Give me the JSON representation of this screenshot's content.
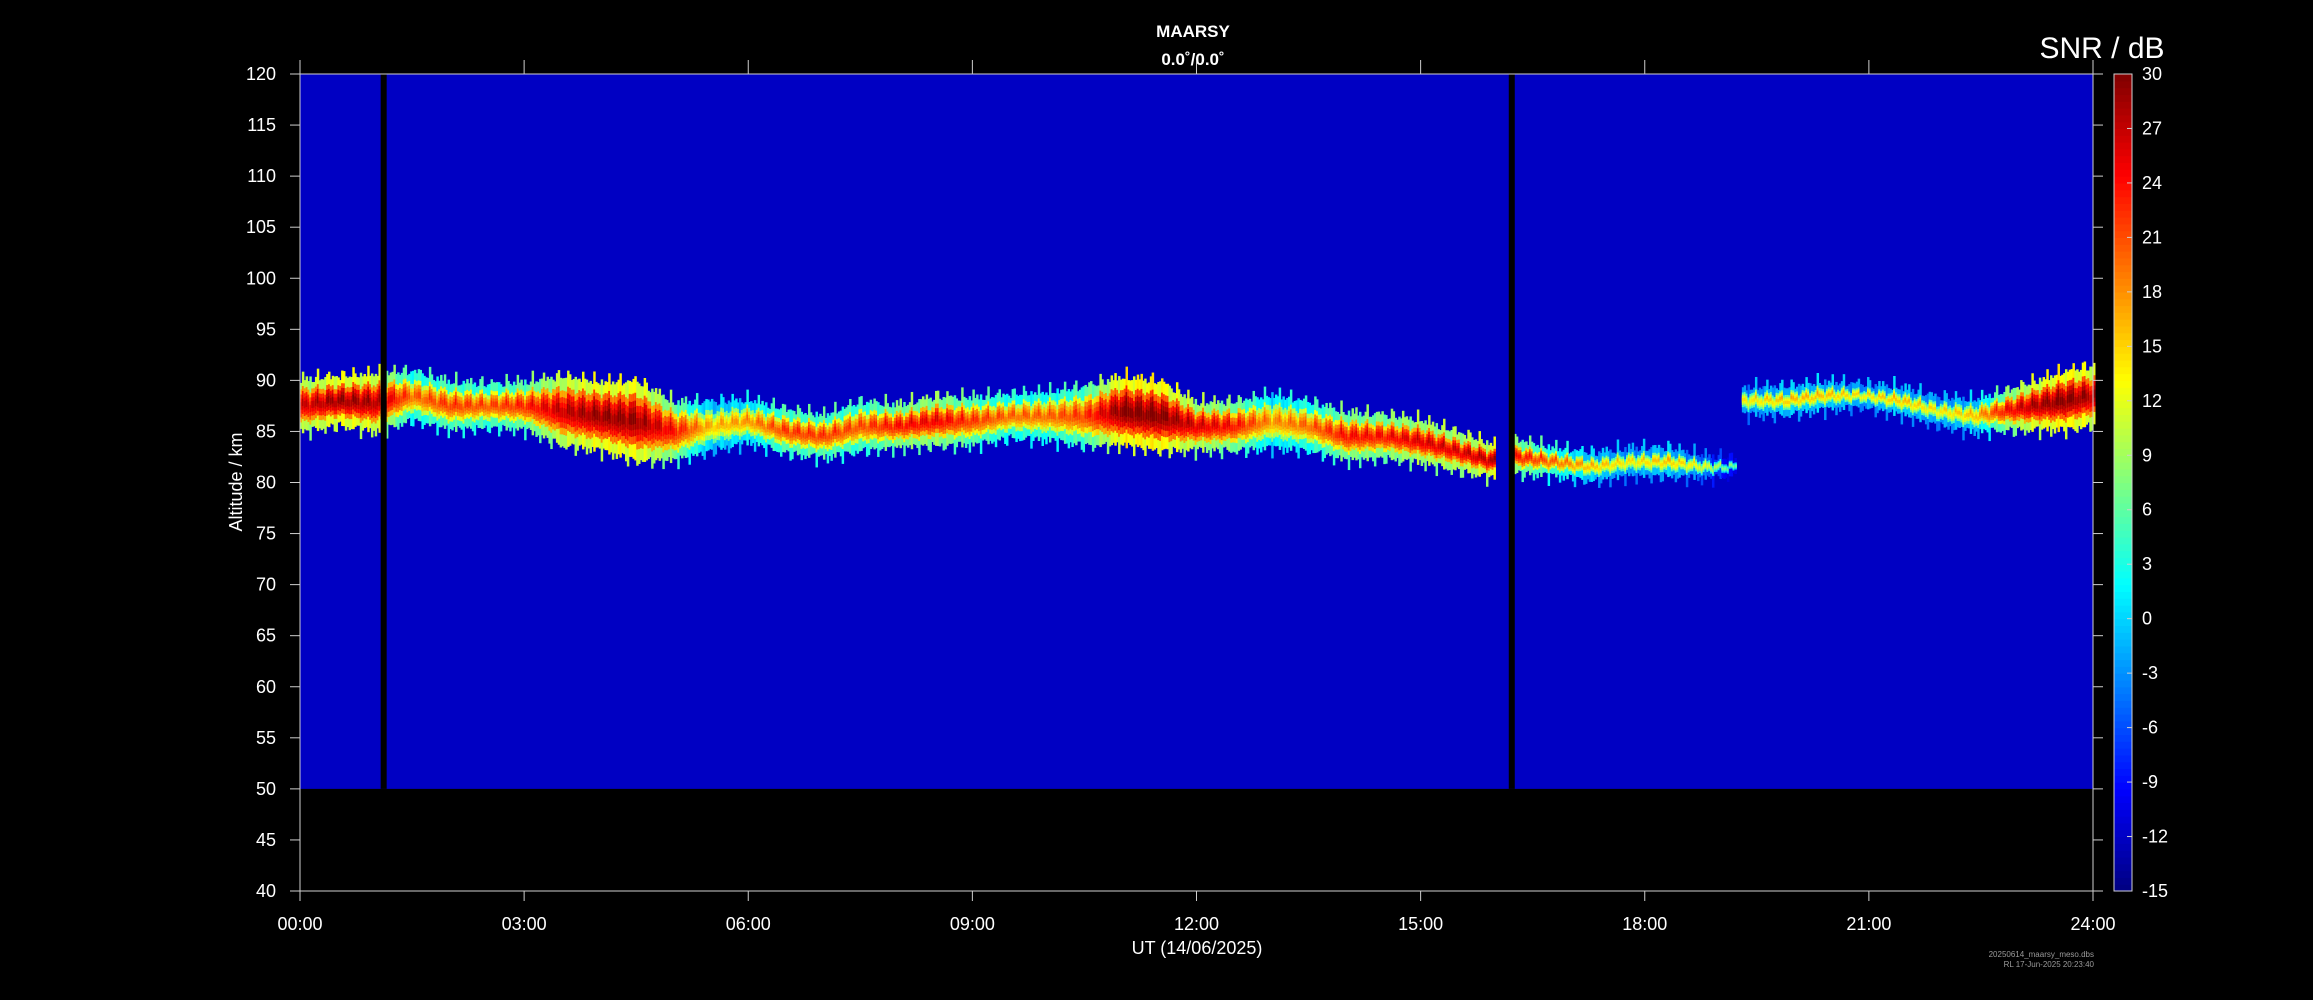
{
  "chart_data": {
    "type": "heatmap",
    "title": "MAARSY",
    "subtitle": "0.0˚/0.0˚",
    "xlabel": "UT (14/06/2025)",
    "ylabel": "Altitude / km",
    "x_range_hours": [
      0,
      24
    ],
    "ylim": [
      40,
      120
    ],
    "x_ticks": [
      "00:00",
      "03:00",
      "06:00",
      "09:00",
      "12:00",
      "15:00",
      "18:00",
      "21:00",
      "24:00"
    ],
    "y_ticks": [
      40,
      45,
      50,
      55,
      60,
      65,
      70,
      75,
      80,
      85,
      90,
      95,
      100,
      105,
      110,
      115,
      120
    ],
    "data_floor_km": 50,
    "background_snr_db": -12,
    "colorbar": {
      "label": "SNR / dB",
      "range": [
        -15,
        30
      ],
      "ticks": [
        -15,
        -12,
        -9,
        -6,
        -3,
        0,
        3,
        6,
        9,
        12,
        15,
        18,
        21,
        24,
        27,
        30
      ],
      "colormap": "jet"
    },
    "data_gaps_ut_hours": [
      1.12,
      16.22
    ],
    "echo_layer": {
      "description_unit": "km",
      "segments": [
        {
          "start_h": 0.0,
          "end_h": 16.0,
          "points": [
            [
              0.0,
              87.5,
              4.5,
              24
            ],
            [
              0.5,
              88,
              4,
              27
            ],
            [
              1.0,
              87.8,
              5,
              26
            ],
            [
              1.5,
              88.5,
              4,
              18
            ],
            [
              2.0,
              87.5,
              4,
              20
            ],
            [
              2.5,
              87.5,
              3.5,
              19
            ],
            [
              3.0,
              87.5,
              4,
              21
            ],
            [
              3.5,
              87,
              6,
              25
            ],
            [
              4.0,
              86.5,
              6,
              27
            ],
            [
              4.5,
              86,
              7,
              27
            ],
            [
              5.0,
              85,
              5,
              22
            ],
            [
              5.5,
              85.5,
              4,
              14
            ],
            [
              6.0,
              86,
              3.5,
              16
            ],
            [
              6.5,
              85,
              3.5,
              20
            ],
            [
              7.0,
              84.5,
              3.5,
              20
            ],
            [
              7.5,
              85.5,
              4,
              19
            ],
            [
              8.0,
              85.5,
              3.5,
              22
            ],
            [
              8.5,
              86,
              4,
              23
            ],
            [
              9.0,
              86,
              4,
              20
            ],
            [
              9.5,
              86.5,
              3.5,
              18
            ],
            [
              10.0,
              86.5,
              4,
              18
            ],
            [
              10.5,
              86.5,
              5,
              20
            ],
            [
              11.0,
              87,
              6,
              28
            ],
            [
              11.5,
              86.5,
              6,
              28
            ],
            [
              12.0,
              85.5,
              4,
              24
            ],
            [
              12.5,
              85.5,
              4,
              22
            ],
            [
              13.0,
              86,
              4.5,
              16
            ],
            [
              13.5,
              85.5,
              4,
              18
            ],
            [
              14.0,
              84.5,
              4,
              22
            ],
            [
              14.5,
              84.5,
              3.5,
              22
            ],
            [
              15.0,
              84,
              3.5,
              24
            ],
            [
              15.5,
              83,
              3,
              24
            ],
            [
              16.0,
              82,
              2.5,
              26
            ]
          ]
        },
        {
          "start_h": 16.25,
          "end_h": 19.2,
          "points": [
            [
              16.3,
              82.5,
              2.5,
              22
            ],
            [
              16.8,
              82,
              2,
              18
            ],
            [
              17.3,
              81.5,
              2,
              14
            ],
            [
              17.8,
              82,
              2,
              12
            ],
            [
              18.3,
              82,
              2,
              14
            ],
            [
              18.8,
              81.5,
              1.5,
              10
            ],
            [
              19.2,
              81.5,
              1,
              4
            ]
          ]
        },
        {
          "start_h": 19.3,
          "end_h": 24.0,
          "points": [
            [
              19.4,
              88,
              2,
              12
            ],
            [
              19.9,
              88,
              2,
              14
            ],
            [
              20.4,
              88.5,
              2,
              14
            ],
            [
              20.9,
              88.5,
              1.5,
              12
            ],
            [
              21.4,
              88,
              2,
              14
            ],
            [
              21.9,
              87,
              2,
              12
            ],
            [
              22.4,
              86.5,
              2.5,
              14
            ],
            [
              22.8,
              87,
              3,
              22
            ],
            [
              23.2,
              87.5,
              4,
              26
            ],
            [
              23.6,
              88,
              5,
              28
            ],
            [
              24.0,
              88.5,
              5,
              26
            ]
          ]
        }
      ]
    }
  },
  "footer": {
    "file_name": "20250614_maarsy_meso.dbs",
    "created": "RL  17-Jun-2025 20:23:40"
  }
}
